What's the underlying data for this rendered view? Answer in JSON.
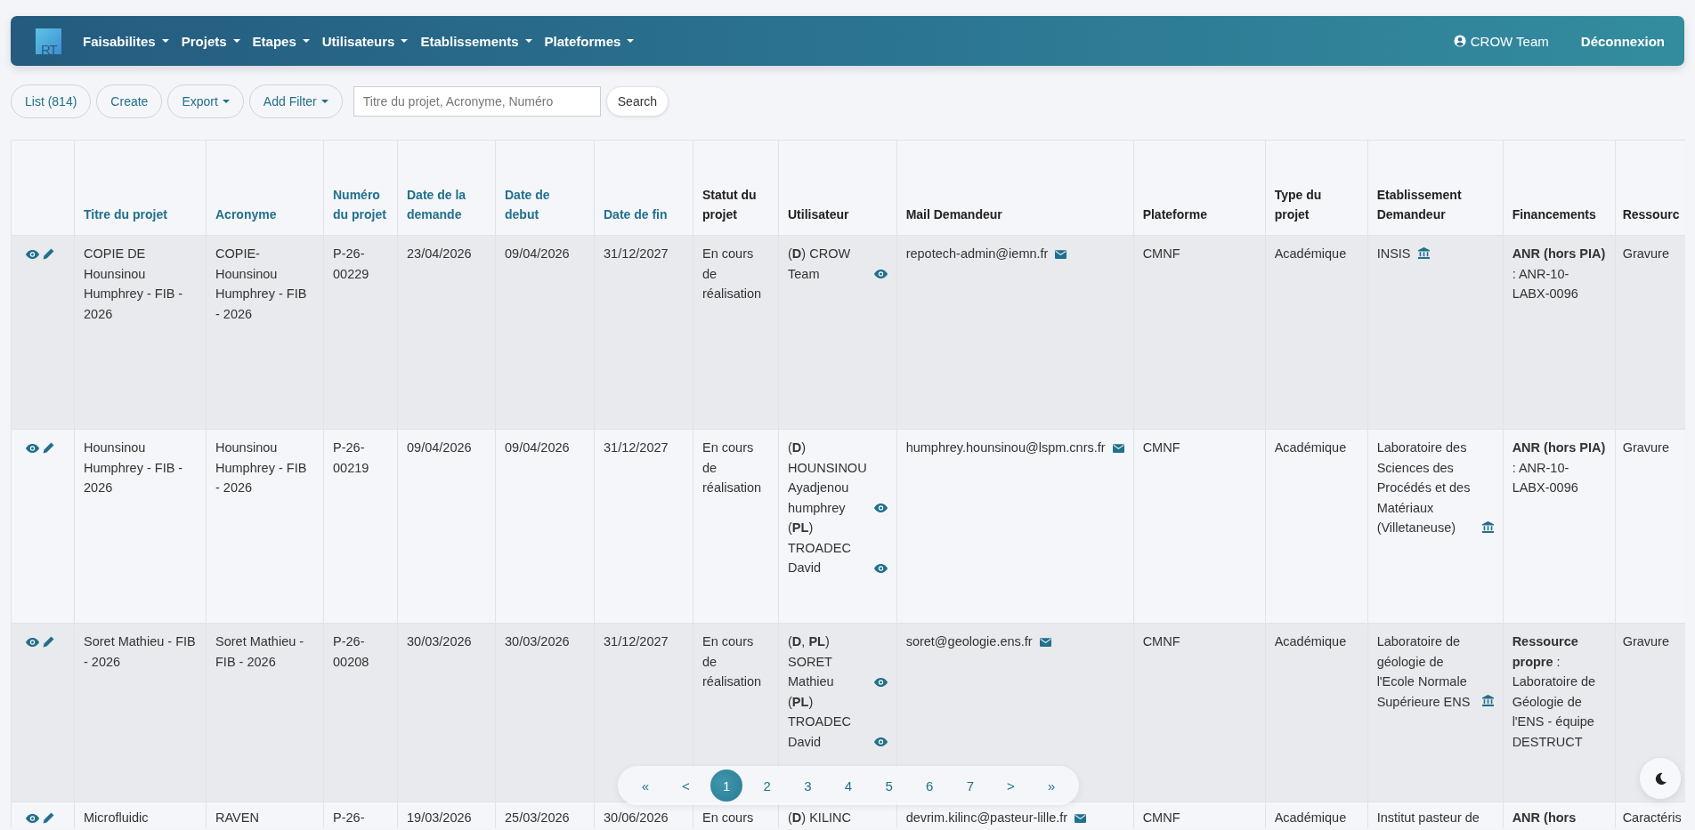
{
  "navbar": {
    "logo_text": "RT",
    "menus": [
      {
        "label": "Faisabilites"
      },
      {
        "label": "Projets"
      },
      {
        "label": "Etapes"
      },
      {
        "label": "Utilisateurs"
      },
      {
        "label": "Etablissements"
      },
      {
        "label": "Plateformes"
      }
    ],
    "user": "CROW Team",
    "logout": "Déconnexion"
  },
  "toolbar": {
    "buttons": [
      {
        "label": "List (814)",
        "dropdown": false
      },
      {
        "label": "Create",
        "dropdown": false
      },
      {
        "label": "Export",
        "dropdown": true
      },
      {
        "label": "Add Filter",
        "dropdown": true
      }
    ],
    "search": {
      "placeholder": "Titre du projet, Acronyme, Numéro"
    },
    "search_button": "Search"
  },
  "table": {
    "columns": [
      {
        "label": "Titre du projet",
        "sortable": true,
        "kind": "text"
      },
      {
        "label": "Acronyme",
        "sortable": true,
        "kind": "text"
      },
      {
        "label": "Numéro du projet",
        "sortable": true,
        "kind": "text"
      },
      {
        "label": "Date de la demande",
        "sortable": true,
        "kind": "text"
      },
      {
        "label": "Date de debut",
        "sortable": true,
        "kind": "text"
      },
      {
        "label": "Date de fin",
        "sortable": true,
        "kind": "text"
      },
      {
        "label": "Statut du projet",
        "sortable": false,
        "kind": "text"
      },
      {
        "label": "Utilisateur",
        "sortable": false,
        "kind": "users"
      },
      {
        "label": "Mail Demandeur",
        "sortable": false,
        "kind": "mail"
      },
      {
        "label": "Plateforme",
        "sortable": false,
        "kind": "text"
      },
      {
        "label": "Type du projet",
        "sortable": false,
        "kind": "text"
      },
      {
        "label": "Etablissement Demandeur",
        "sortable": false,
        "kind": "institution"
      },
      {
        "label": "Financements",
        "sortable": false,
        "kind": "funding"
      },
      {
        "label": "Ressourc",
        "sortable": false,
        "kind": "text"
      }
    ],
    "rows": [
      {
        "cells": [
          {
            "text": "COPIE DE Hounsinou Humphrey - FIB - 2026"
          },
          {
            "text": "COPIE-Hounsinou Humphrey - FIB - 2026"
          },
          {
            "text": "P-26-00229"
          },
          {
            "text": "23/04/2026"
          },
          {
            "text": "09/04/2026"
          },
          {
            "text": "31/12/2027"
          },
          {
            "text": "En cours de réalisation"
          },
          {
            "users": [
              {
                "label": "(**D**) CROW Team",
                "view_icon": true
              }
            ]
          },
          {
            "text": "repotech-admin@iemn.fr",
            "icon": true
          },
          {
            "text": "CMNF"
          },
          {
            "text": "Académique"
          },
          {
            "text": "INSIS",
            "icon": true
          },
          {
            "text": "**ANR (hors PIA)** : ANR-10-LABX-0096"
          },
          {
            "text": "Gravure"
          }
        ]
      },
      {
        "cells": [
          {
            "text": "Hounsinou Humphrey - FIB - 2026"
          },
          {
            "text": "Hounsinou Humphrey - FIB - 2026"
          },
          {
            "text": "P-26-00219"
          },
          {
            "text": "09/04/2026"
          },
          {
            "text": "09/04/2026"
          },
          {
            "text": "31/12/2027"
          },
          {
            "text": "En cours de réalisation"
          },
          {
            "users": [
              {
                "label": "(**D**) HOUNSINOU Ayadjenou humphrey",
                "view_icon": true
              },
              {
                "label": "(**PL**) TROADEC David",
                "view_icon": true
              }
            ]
          },
          {
            "text": "humphrey.hounsinou@lspm.cnrs.fr",
            "icon": true
          },
          {
            "text": "CMNF"
          },
          {
            "text": "Académique"
          },
          {
            "text": "Laboratoire des Sciences des Procédés et des Matériaux (Villetaneuse)",
            "icon": true
          },
          {
            "text": "**ANR (hors PIA)** : ANR-10-LABX-0096"
          },
          {
            "text": "Gravure"
          }
        ]
      },
      {
        "cells": [
          {
            "text": "Soret Mathieu - FIB - 2026"
          },
          {
            "text": "Soret Mathieu - FIB - 2026"
          },
          {
            "text": "P-26-00208"
          },
          {
            "text": "30/03/2026"
          },
          {
            "text": "30/03/2026"
          },
          {
            "text": "31/12/2027"
          },
          {
            "text": "En cours de réalisation"
          },
          {
            "users": [
              {
                "label": "(**D**, **PL**) SORET Mathieu",
                "view_icon": true
              },
              {
                "label": "(**PL**) TROADEC David",
                "view_icon": true
              }
            ]
          },
          {
            "text": "soret@geologie.ens.fr",
            "icon": true
          },
          {
            "text": "CMNF"
          },
          {
            "text": "Académique"
          },
          {
            "text": "Laboratoire de géologie de l'Ecole Normale Supérieure ENS",
            "icon": true
          },
          {
            "text": "**Ressource propre** : Laboratoire de Géologie de l'ENS - équipe DESTRUCT"
          },
          {
            "text": "Gravure"
          }
        ]
      },
      {
        "cells": [
          {
            "text": "Microfluidic"
          },
          {
            "text": "RAVEN"
          },
          {
            "text": "P-26-"
          },
          {
            "text": "19/03/2026"
          },
          {
            "text": "25/03/2026"
          },
          {
            "text": "30/06/2026"
          },
          {
            "text": "En cours"
          },
          {
            "users": [
              {
                "label": "(**D**) KILINC",
                "view_icon": false
              }
            ]
          },
          {
            "text": "devrim.kilinc@pasteur-lille.fr",
            "icon": true
          },
          {
            "text": "CMNF"
          },
          {
            "text": "Académique"
          },
          {
            "text": "Institut pasteur de",
            "icon": false
          },
          {
            "text": "**ANR (hors**"
          },
          {
            "text": "Caractéris"
          }
        ]
      }
    ]
  },
  "pagination": [
    {
      "label": "«",
      "selected": false
    },
    {
      "label": "<",
      "selected": false
    },
    {
      "label": "1",
      "selected": true
    },
    {
      "label": "2",
      "selected": false
    },
    {
      "label": "3",
      "selected": false
    },
    {
      "label": "4",
      "selected": false
    },
    {
      "label": "5",
      "selected": false
    },
    {
      "label": "6",
      "selected": false
    },
    {
      "label": "7",
      "selected": false
    },
    {
      "label": ">",
      "selected": false
    },
    {
      "label": "»",
      "selected": false
    }
  ]
}
